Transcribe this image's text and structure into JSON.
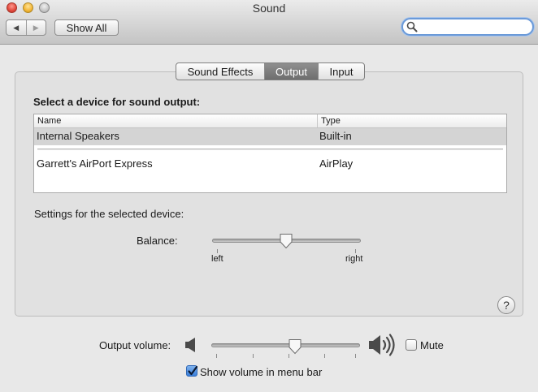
{
  "window": {
    "title": "Sound"
  },
  "toolbar": {
    "back_icon": "triangle-left",
    "forward_icon": "triangle-right",
    "show_all_label": "Show All",
    "search_value": "",
    "search_placeholder": ""
  },
  "tabs": [
    {
      "label": "Sound Effects",
      "selected": false
    },
    {
      "label": "Output",
      "selected": true
    },
    {
      "label": "Input",
      "selected": false
    }
  ],
  "output_panel": {
    "heading": "Select a device for sound output:",
    "columns": {
      "name": "Name",
      "type": "Type"
    },
    "devices": [
      {
        "name": "Internal Speakers",
        "type": "Built-in",
        "selected": true
      },
      {
        "name": "Garrett's AirPort Express",
        "type": "AirPlay",
        "selected": false
      }
    ],
    "settings_label": "Settings for the selected device:",
    "balance": {
      "label": "Balance:",
      "left_label": "left",
      "right_label": "right",
      "value": 0.5
    },
    "help_label": "?"
  },
  "output_volume": {
    "label": "Output volume:",
    "value": 0.56,
    "mute_label": "Mute",
    "muted": false
  },
  "menu_bar": {
    "show_volume_label": "Show volume in menu bar",
    "checked": true
  },
  "colors": {
    "selected_tab": "#7a7a7a",
    "selected_row": "#d4d4d4",
    "search_focus": "#6b9ad8",
    "checkbox_checked": "#3a7fdb"
  }
}
